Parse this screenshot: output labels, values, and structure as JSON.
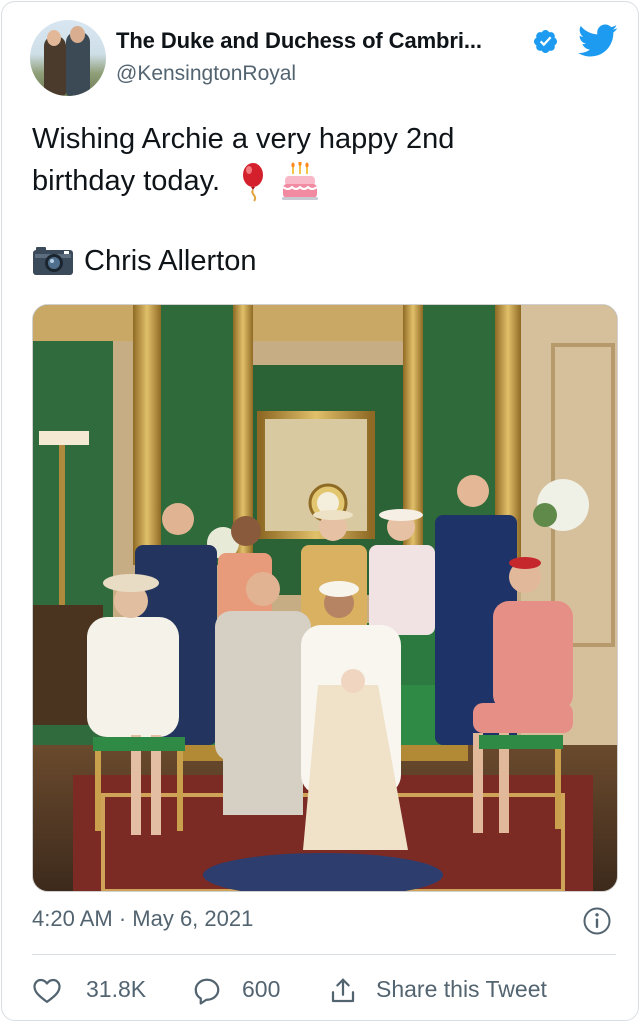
{
  "author": {
    "display_name": "The Duke and Duchess of Cambri...",
    "handle": "@KensingtonRoyal",
    "verified": true
  },
  "tweet": {
    "text_line1": "Wishing Archie a very happy 2nd",
    "text_line2": "birthday today.",
    "emojis": [
      "balloon-icon",
      "birthday-cake-icon"
    ],
    "credit_icon": "camera-icon",
    "credit": "Chris Allerton"
  },
  "media": {
    "type": "photo"
  },
  "meta": {
    "timestamp": "4:20 AM · May 6, 2021"
  },
  "actions": {
    "like_count": "31.8K",
    "reply_count": "600",
    "share_label": "Share this Tweet"
  },
  "colors": {
    "twitter_blue": "#1d9bf0",
    "secondary_text": "#536471",
    "primary_text": "#0f1419",
    "divider": "#d9dee2"
  }
}
